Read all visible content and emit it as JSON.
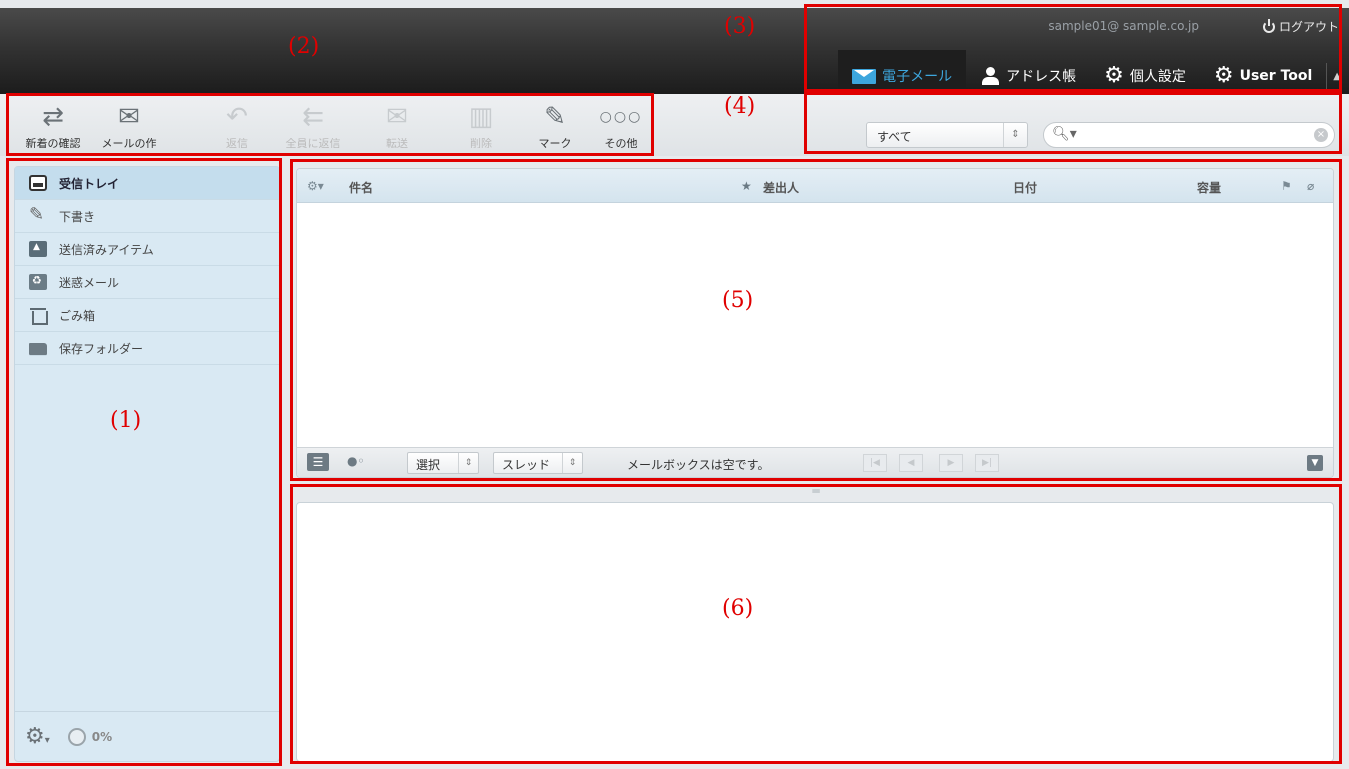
{
  "header": {
    "user_email": "sample01@ sample.co.jp",
    "logout_label": "ログアウト",
    "app_tabs": [
      {
        "label": "電子メール",
        "icon": "mail-icon",
        "active": true
      },
      {
        "label": "アドレス帳",
        "icon": "person-icon",
        "active": false
      },
      {
        "label": "個人設定",
        "icon": "gear-icon",
        "active": false
      },
      {
        "label": "User Tool",
        "icon": "user-gear-icon",
        "active": false
      }
    ]
  },
  "toolbar": {
    "buttons": [
      {
        "label": "新着の確認",
        "icon": "refresh-arrows-icon",
        "enabled": true
      },
      {
        "label": "メールの作成",
        "icon": "compose-icon",
        "enabled": true
      },
      {
        "label": "返信",
        "icon": "reply-icon",
        "enabled": false
      },
      {
        "label": "全員に返信",
        "icon": "reply-all-icon",
        "enabled": false
      },
      {
        "label": "転送",
        "icon": "forward-icon",
        "enabled": false
      },
      {
        "label": "削除",
        "icon": "trash-icon",
        "enabled": false
      },
      {
        "label": "マーク",
        "icon": "mark-icon",
        "enabled": true
      },
      {
        "label": "その他",
        "icon": "more-icon",
        "enabled": true
      }
    ]
  },
  "search": {
    "filter_value": "すべて",
    "placeholder": ""
  },
  "folders": {
    "items": [
      {
        "label": "受信トレイ",
        "icon": "inbox-icon",
        "active": true
      },
      {
        "label": "下書き",
        "icon": "pencil-icon",
        "active": false
      },
      {
        "label": "送信済みアイテム",
        "icon": "sent-icon",
        "active": false
      },
      {
        "label": "迷惑メール",
        "icon": "junk-icon",
        "active": false
      },
      {
        "label": "ごみ箱",
        "icon": "trash-icon",
        "active": false
      },
      {
        "label": "保存フォルダー",
        "icon": "folder-icon",
        "active": false
      }
    ],
    "quota_text": "0%",
    "quota_fraction": 0
  },
  "message_list": {
    "columns": {
      "subject": "件名",
      "from": "差出人",
      "date": "日付",
      "size": "容量"
    },
    "footer": {
      "select_label": "選択",
      "thread_label": "スレッド",
      "status": "メールボックスは空です。"
    }
  },
  "annotations": [
    "(1)",
    "(2)",
    "(3)",
    "(4)",
    "(5)",
    "(6)"
  ],
  "colors": {
    "annotation": "#e00000",
    "active_tab": "#3da6dd",
    "folder_bg": "#d9e9f3"
  }
}
